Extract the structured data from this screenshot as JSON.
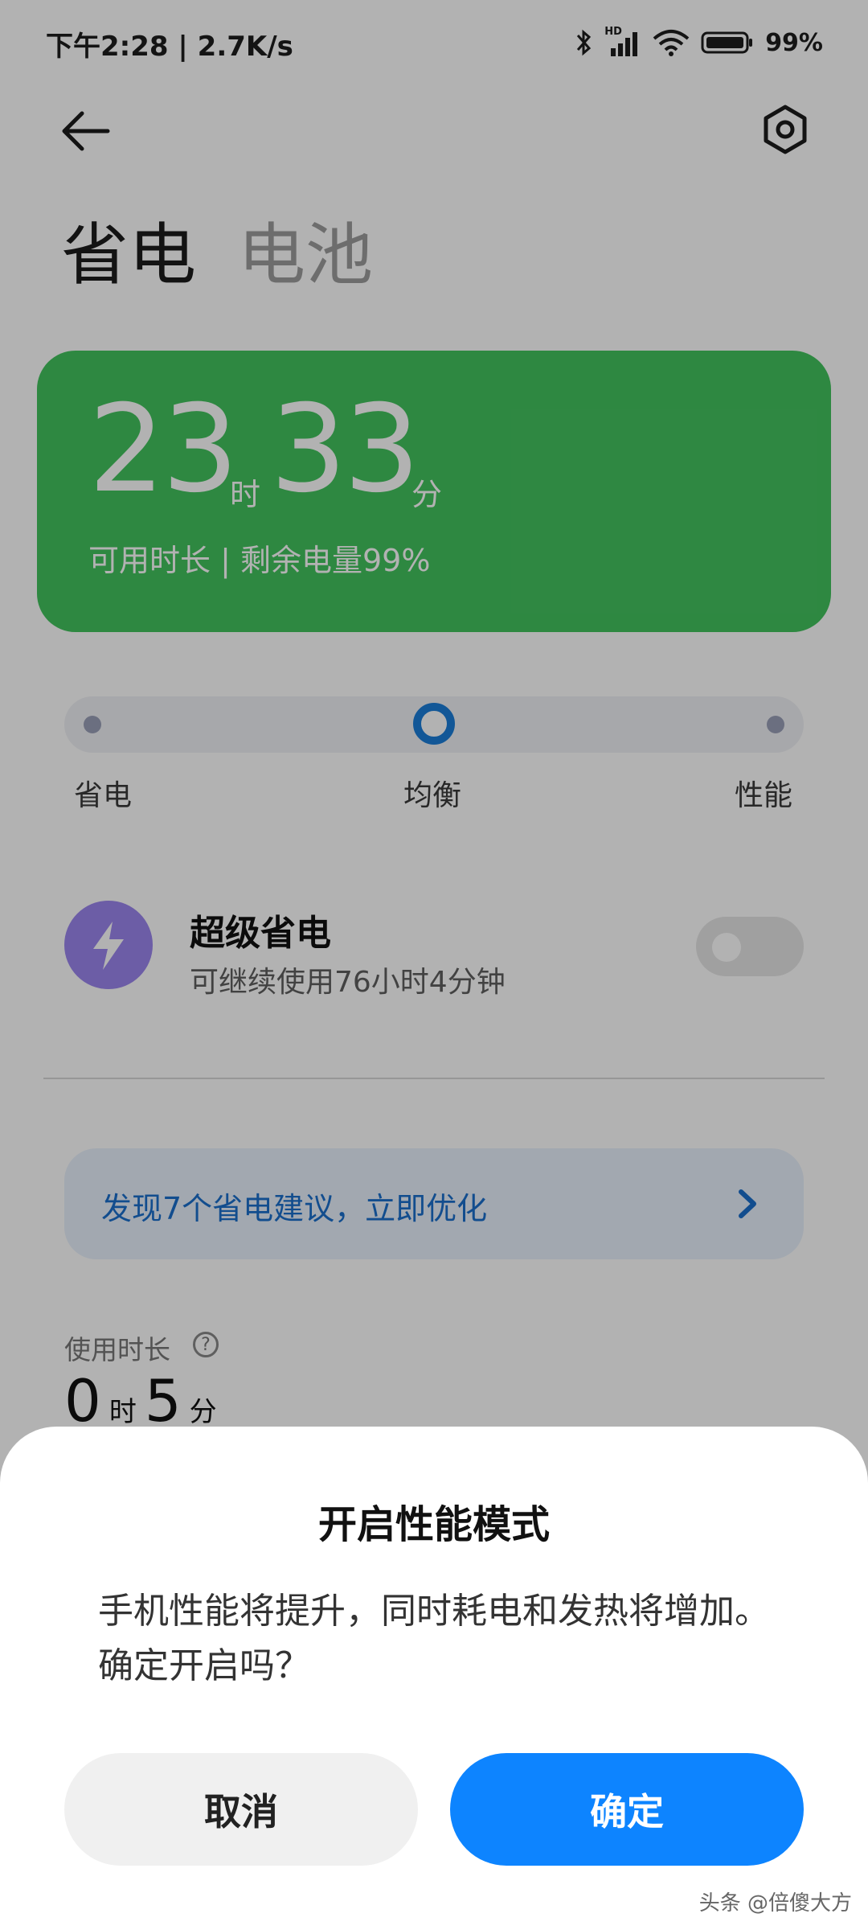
{
  "status_bar": {
    "time": "下午2:28 | 2.7K/s",
    "network_badge": "HD",
    "battery_percent": "99%",
    "icons": [
      "bluetooth-icon",
      "signal-icon",
      "wifi-icon",
      "battery-icon"
    ]
  },
  "header": {
    "title_active": "省电",
    "title_inactive": "电池",
    "back_icon": "arrow-left-icon",
    "settings_icon": "settings-gear-icon"
  },
  "battery_card": {
    "hours": "23",
    "hours_unit": "时",
    "minutes": "33",
    "minutes_unit": "分",
    "subtitle": "可用时长 | 剩余电量99%",
    "color": "#43c35e"
  },
  "mode_slider": {
    "options": [
      "省电",
      "均衡",
      "性能"
    ],
    "selected": "均衡",
    "accent": "#1a7dd8"
  },
  "super_save": {
    "title": "超级省电",
    "subtitle": "可继续使用76小时4分钟",
    "enabled": false,
    "icon": "lightning-bolt-icon"
  },
  "suggestion": {
    "text": "发现7个省电建议，立即优化",
    "icon": "chevron-right-icon"
  },
  "usage": {
    "label": "使用时长",
    "hours": "0",
    "hours_unit": "时",
    "minutes": "5",
    "minutes_unit": "分"
  },
  "dialog": {
    "title": "开启性能模式",
    "message": "手机性能将提升，同时耗电和发热将增加。确定开启吗？",
    "cancel_label": "取消",
    "confirm_label": "确定",
    "confirm_color": "#0d84ff"
  },
  "watermark": "头条 @倍傻大方"
}
